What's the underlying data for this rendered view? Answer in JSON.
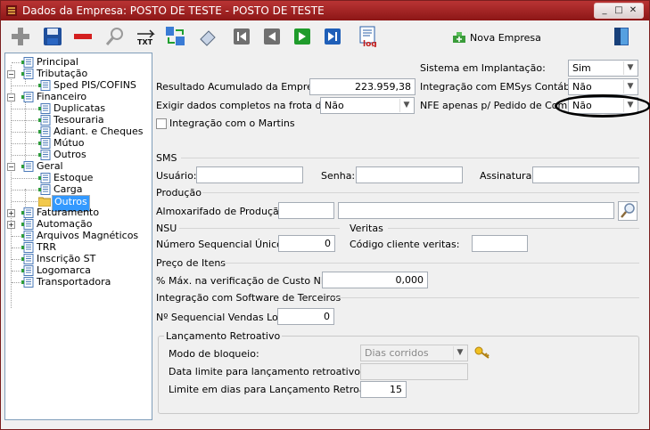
{
  "window": {
    "title": "Dados da Empresa: POSTO DE TESTE - POSTO DE TESTE",
    "min_glyph": "_",
    "max_glyph": "□",
    "close_glyph": "✕"
  },
  "toolbar": {
    "icons": [
      "add-icon",
      "save-icon",
      "remove-icon",
      "search-icon",
      "txt-export-icon",
      "transfer-icon",
      "eraser-icon",
      "first-record-icon",
      "previous-record-icon",
      "next-record-icon",
      "last-record-icon",
      "log-icon"
    ],
    "txt_label": "TXT",
    "log_label": "log",
    "nova_empresa": "Nova Empresa"
  },
  "tree": {
    "items": [
      {
        "label": "Principal"
      },
      {
        "label": "Tributação",
        "expander": "⊟"
      },
      {
        "label": "Sped PIS/COFINS"
      },
      {
        "label": "Financeiro",
        "expander": "⊟"
      },
      {
        "label": "Duplicatas"
      },
      {
        "label": "Tesouraria"
      },
      {
        "label": "Adiant. e Cheques"
      },
      {
        "label": "Mútuo"
      },
      {
        "label": "Outros"
      },
      {
        "label": "Geral",
        "expander": "⊟"
      },
      {
        "label": "Estoque"
      },
      {
        "label": "Carga"
      },
      {
        "label": "Outros",
        "selected": true
      },
      {
        "label": "Faturamento",
        "expander": "⊞"
      },
      {
        "label": "Automação",
        "expander": "⊞"
      },
      {
        "label": "Arquivos Magnéticos"
      },
      {
        "label": "TRR"
      },
      {
        "label": "Inscrição ST"
      },
      {
        "label": "Logomarca"
      },
      {
        "label": "Transportadora"
      }
    ]
  },
  "form": {
    "sistema_implantacao_label": "Sistema em Implantação:",
    "sistema_implantacao_value": "Sim",
    "resultado_label": "Resultado Acumulado da Empresa:",
    "resultado_value": "223.959,38",
    "integracao_emsys_label": "Integração com EMSys Contábil:",
    "integracao_emsys_value": "Não",
    "exigir_label": "Exigir dados completos na frota de clientes:",
    "exigir_value": "Não",
    "nfe_label": "NFE apenas p/ Pedido de Compra:",
    "nfe_value": "Não",
    "martins_label": "Integração com o Martins",
    "sms_section": "SMS",
    "usuario_label": "Usuário:",
    "usuario_value": "",
    "senha_label": "Senha:",
    "senha_value": "",
    "assinatura_label": "Assinatura:",
    "assinatura_value": "",
    "producao_section": "Produção",
    "almox_label": "Almoxarifado de Produção:",
    "almox_code": "",
    "almox_name": "",
    "nsu_section": "NSU",
    "veritas_section": "Veritas",
    "nsu_label": "Número Sequencial Único:",
    "nsu_value": "0",
    "veritas_label": "Código cliente veritas:",
    "veritas_value": "",
    "preco_section": "Preço de Itens",
    "custo_label": "% Máx. na verificação de Custo NFE:",
    "custo_value": "0,000",
    "integracao_terceiros_section": "Integração com Software de Terceiros",
    "vendas_label": "Nº Sequencial Vendas Loja:",
    "vendas_value": "0",
    "retro_group": "Lançamento Retroativo",
    "modo_label": "Modo de bloqueio:",
    "modo_value": "Dias corridos",
    "data_limite_label": "Data limite para lançamento retroativo:",
    "data_limite_value": "",
    "limite_dias_label": "Limite em dias para Lançamento Retroativo:",
    "limite_dias_value": "15"
  },
  "colors": {
    "titlebar": "#a32626",
    "selection": "#3399ff",
    "annotation": "#000000"
  }
}
